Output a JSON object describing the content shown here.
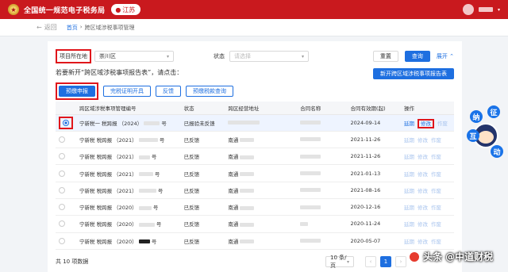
{
  "header": {
    "bureau": "全国统一规范电子税务局",
    "region": "江苏"
  },
  "breadcrumb": {
    "back": "返回",
    "home": "首页",
    "sep": "›",
    "current": "跨区域涉税事项管理"
  },
  "filter": {
    "location_label": "项目所在地",
    "location_value": "崇川区",
    "status_label": "状态",
    "status_placeholder": "请选择",
    "reset": "重置",
    "query": "查询",
    "expand": "展开"
  },
  "prompt": "若要新开“跨区域涉税事项报告表”，请点击：",
  "new_report_button": "新开跨区域涉税事项报告表",
  "actions": [
    "预缴申报",
    "完税证明开具",
    "反馈",
    "预缴税款查询"
  ],
  "table": {
    "columns": [
      "",
      "跨区域涉税事项管理编号",
      "状态",
      "跨区经营地址",
      "合同名称",
      "合同有效期(起)",
      "操作"
    ],
    "ops": [
      "延期",
      "修改",
      "作废"
    ],
    "rows": [
      {
        "id": "宁新税一 税跨报 （2024）",
        "suffix": "号",
        "status": "已报验未反馈",
        "addr": "",
        "contract": "",
        "date": "2024-09-14",
        "selected": true
      },
      {
        "id": "宁新税 税跨报 （2021）",
        "suffix": "号",
        "status": "已反馈",
        "addr": "南通",
        "contract": "",
        "date": "2021-11-26"
      },
      {
        "id": "宁新税 税跨报 （2021）",
        "suffix": "号",
        "status": "已反馈",
        "addr": "南通",
        "contract": "",
        "date": "2021-11-26"
      },
      {
        "id": "宁新税 税跨报 （2021）",
        "suffix": "号",
        "status": "已反馈",
        "addr": "南通",
        "contract": "",
        "date": "2021-01-13"
      },
      {
        "id": "宁新税 税跨报 （2021）",
        "suffix": "号",
        "status": "已反馈",
        "addr": "南通",
        "contract": "",
        "date": "2021-08-16"
      },
      {
        "id": "宁新税 税跨报 （2020）",
        "suffix": "号",
        "status": "已反馈",
        "addr": "南通",
        "contract": "",
        "date": "2020-12-16"
      },
      {
        "id": "宁新税 税跨报 （2020）",
        "suffix": "号",
        "status": "已反馈",
        "addr": "南通",
        "contract": "",
        "date": "2020-11-24"
      },
      {
        "id": "宁新税 税跨报 （2020）",
        "suffix": "号",
        "status": "已反馈",
        "addr": "南通",
        "contract": "",
        "date": "2020-05-07"
      }
    ]
  },
  "footer": {
    "total": "共 10 项数据",
    "page_size": "10 条/页",
    "current_page": "1",
    "prev": "‹",
    "next": "›"
  },
  "mascot": {
    "chars": [
      "征",
      "纳",
      "互",
      "动"
    ]
  },
  "watermark": "头条 @中道财税",
  "colors": {
    "brand_red": "#c9191e",
    "primary_blue": "#1e6fe0",
    "highlight_red": "#e0161b"
  }
}
